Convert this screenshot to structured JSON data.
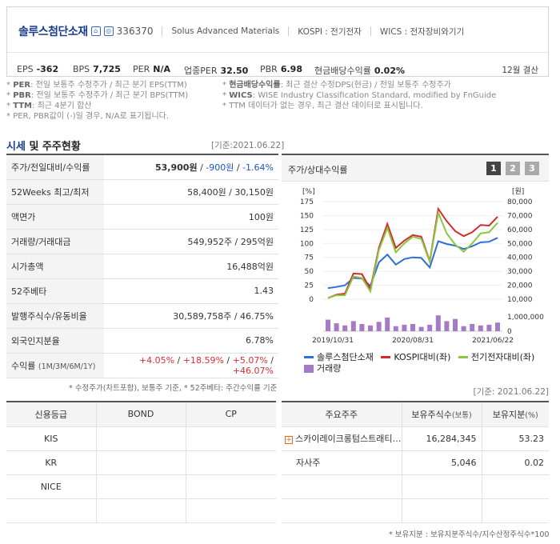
{
  "company": {
    "name": "솔루스첨단소재",
    "code": "336370",
    "eng_name": "Solus Advanced Materials",
    "market": "KOSPI : 전기전자",
    "wics": "WICS : 전자장비와기기"
  },
  "metrics": [
    {
      "label": "EPS",
      "value": "-362"
    },
    {
      "label": "BPS",
      "value": "7,725"
    },
    {
      "label": "PER",
      "value": "N/A"
    },
    {
      "label": "업종PER",
      "value": "32.50"
    },
    {
      "label": "PBR",
      "value": "6.98"
    },
    {
      "label": "현금배당수익률",
      "value": "0.02%"
    }
  ],
  "settlement": "12월 결산",
  "notes": {
    "left": [
      {
        "key": "PER",
        "text": ": 전일 보통주 수정주가 / 최근 분기 EPS(TTM)"
      },
      {
        "key": "PBR",
        "text": ": 전일 보통주 수정주가 / 최근 분기 BPS(TTM)"
      },
      {
        "key": "TTM",
        "text": ": 최근 4분기 합산"
      },
      {
        "key": "",
        "text": "PER, PBR값이 (-)일 경우, N/A로 표기됩니다."
      }
    ],
    "right": [
      {
        "key": "현금배당수익률",
        "text": ": 최근 결산 수정DPS(현금) / 전일 보통주 수정주가"
      },
      {
        "key": "WICS",
        "text": ": WISE Industry Classification Standard, modified by FnGuide"
      },
      {
        "key": "",
        "text": "TTM 데이터가 없는 경우, 최근 결산 데이터로 표시됩니다."
      }
    ]
  },
  "section": {
    "title_accent": "시세",
    "title_rest": " 및 주주현황",
    "ref_date": "[기준:2021.06.22]"
  },
  "price_rows": [
    {
      "label": "주가/전일대비/수익률"
    },
    {
      "label": "52Weeks 최고/최저",
      "value": "58,400원 / 30,150원"
    },
    {
      "label": "액면가",
      "value": "100원"
    },
    {
      "label": "거래량/거래대금",
      "value": "549,952주 / 295억원"
    },
    {
      "label": "시가총액",
      "value": "16,488억원"
    },
    {
      "label": "52주베타",
      "value": "1.43"
    },
    {
      "label": "발행주식수/유동비율",
      "value": "30,589,758주 / 46.75%"
    },
    {
      "label": "외국인지분율",
      "value": "6.78%"
    },
    {
      "label": "수익률",
      "label_small": "(1M/3M/6M/1Y)"
    }
  ],
  "price": {
    "price": "53,900원",
    "sep1": " / ",
    "change": "-900원",
    "sep2": " / ",
    "rate": "-1.64%"
  },
  "returns": [
    "+4.05%",
    " / ",
    "+18.59%",
    " / ",
    "+5.07%",
    " / ",
    "+46.07%"
  ],
  "footnote_left": "* 수정주가(차트포함), 보통주 기준, * 52주베타: 주간수익률 기준",
  "chart": {
    "title": "주가/상대수익률",
    "pages": [
      "1",
      "2",
      "3"
    ],
    "colors": {
      "company": "#2f6fd6",
      "kospi": "#d22b2b",
      "sector": "#8cc63f",
      "volume": "#a57ac9"
    }
  },
  "chart_data": {
    "type": "line",
    "left_unit": "[%]",
    "right_unit": "[원]",
    "y_left_ticks": [
      "175",
      "150",
      "125",
      "100",
      "75",
      "50",
      "25",
      "0"
    ],
    "y_right_ticks": [
      "80,000",
      "70,000",
      "60,000",
      "50,000",
      "40,000",
      "30,000",
      "20,000",
      "10,000"
    ],
    "y_left_range": [
      0,
      175
    ],
    "volume_tick_labels": [
      "1,000,000",
      "0"
    ],
    "x_tick_labels": [
      "2019/10/31",
      "2020/08/31",
      "2021/06/22"
    ],
    "series": [
      {
        "name": "솔루스첨단소재",
        "values": [
          20,
          22,
          25,
          38,
          37,
          24,
          66,
          80,
          62,
          72,
          75,
          74,
          57,
          104,
          99,
          96,
          90,
          95,
          102,
          103,
          110
        ]
      },
      {
        "name": "KOSPI대비(좌)",
        "values": [
          2,
          8,
          10,
          46,
          45,
          18,
          92,
          135,
          92,
          105,
          115,
          112,
          68,
          162,
          140,
          122,
          113,
          120,
          133,
          132,
          148
        ]
      },
      {
        "name": "전기전자대비(좌)",
        "values": [
          2,
          7,
          7,
          41,
          38,
          14,
          88,
          128,
          84,
          100,
          112,
          108,
          67,
          155,
          118,
          98,
          85,
          100,
          118,
          120,
          137
        ]
      }
    ],
    "volume": {
      "name": "거래량",
      "values": [
        0.8,
        0.55,
        0.4,
        0.7,
        0.5,
        0.4,
        0.65,
        0.95,
        0.35,
        0.45,
        0.5,
        0.3,
        0.45,
        1.1,
        0.7,
        0.85,
        0.35,
        0.5,
        0.4,
        0.45,
        0.6
      ]
    }
  },
  "grades": {
    "headers": [
      "신용등급",
      "BOND",
      "CP"
    ],
    "rows": [
      [
        "KIS",
        "",
        ""
      ],
      [
        "KR",
        "",
        ""
      ],
      [
        "NICE",
        "",
        ""
      ],
      [
        "",
        "",
        ""
      ]
    ]
  },
  "holders": {
    "ref_date": "[기준: 2021.06.22]",
    "headers": [
      "주요주주",
      "보유주식수",
      "(보통)",
      "보유지분",
      "(%)"
    ],
    "rows": [
      {
        "name": "스카이레이크롱텀스트래티…",
        "shares": "16,284,345",
        "pct": "53.23"
      },
      {
        "name": "자사주",
        "shares": "5,046",
        "pct": "0.02"
      },
      {
        "name": "",
        "shares": "",
        "pct": ""
      },
      {
        "name": "",
        "shares": "",
        "pct": ""
      }
    ],
    "footnote": "* 보유지분 : 보유지분주식수/지수산정주식수*100"
  }
}
